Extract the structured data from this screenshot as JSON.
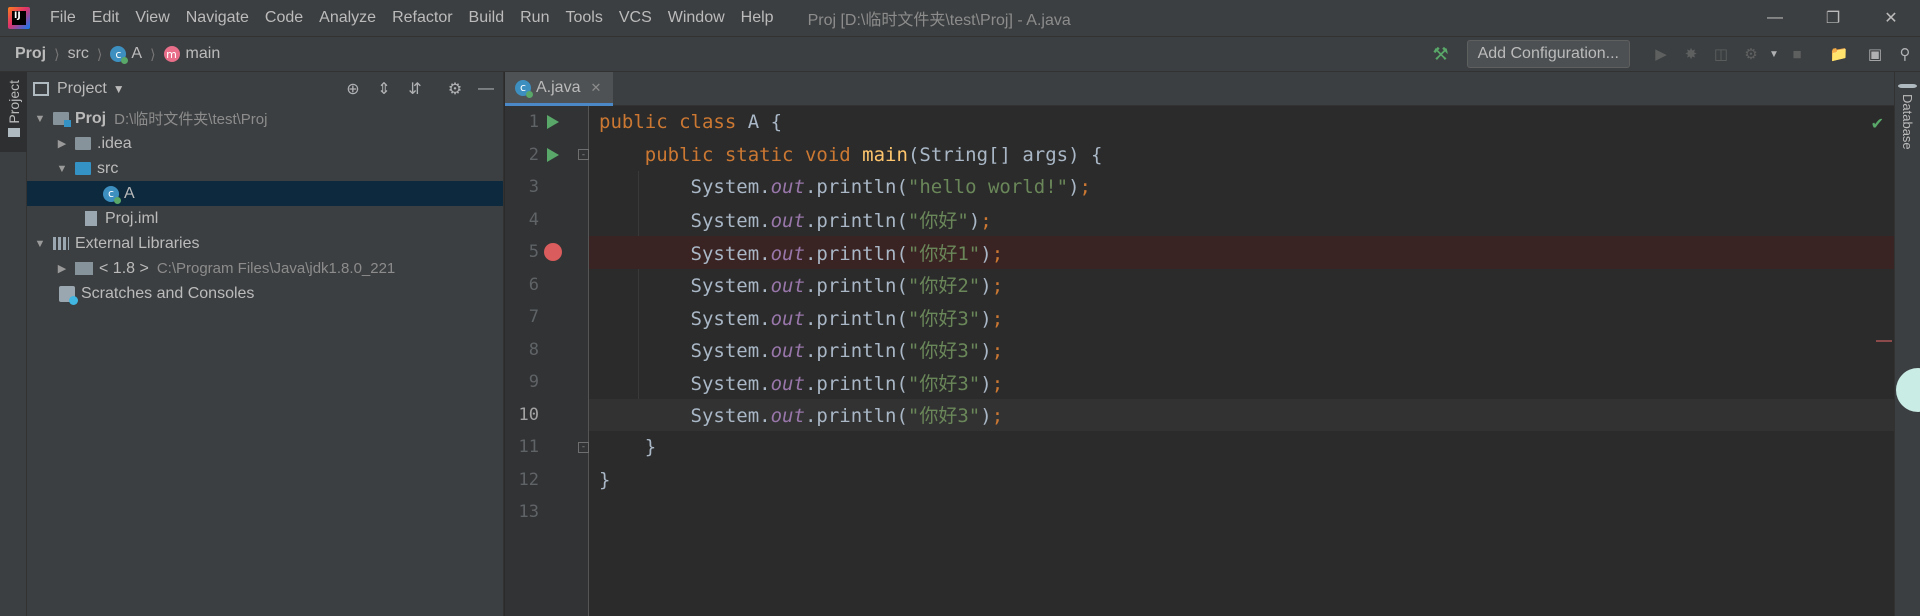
{
  "titlebar": {
    "menu": [
      "File",
      "Edit",
      "View",
      "Navigate",
      "Code",
      "Analyze",
      "Refactor",
      "Build",
      "Run",
      "Tools",
      "VCS",
      "Window",
      "Help"
    ],
    "window_title": "Proj [D:\\临时文件夹\\test\\Proj] - A.java"
  },
  "navbar": {
    "crumbs": [
      "Proj",
      "src",
      "A",
      "main"
    ],
    "add_configuration": "Add Configuration..."
  },
  "left_stripe": {
    "project_tab": "Project"
  },
  "project_panel": {
    "title": "Project",
    "tree": {
      "root_name": "Proj",
      "root_path": "D:\\临时文件夹\\test\\Proj",
      "idea": ".idea",
      "src": "src",
      "class_a": "A",
      "iml": "Proj.iml",
      "external_libraries": "External Libraries",
      "jdk_name": "< 1.8 >",
      "jdk_path": "C:\\Program Files\\Java\\jdk1.8.0_221",
      "scratches": "Scratches and Consoles"
    }
  },
  "editor": {
    "tab_label": "A.java",
    "line_numbers": [
      "1",
      "2",
      "3",
      "4",
      "5",
      "6",
      "7",
      "8",
      "9",
      "10",
      "11",
      "12",
      "13"
    ],
    "tokens": {
      "public": "public",
      "class": "class",
      "static": "static",
      "void": "void",
      "class_name": "A",
      "method_name": "main",
      "system": "System",
      "out": "out",
      "println": "println",
      "string_type": "String",
      "args": "args",
      "s1": "\"hello world!\"",
      "s2": "\"你好\"",
      "s3": "\"你好1\"",
      "s4": "\"你好2\"",
      "s5": "\"你好3\""
    },
    "breakpoint_line": 5,
    "current_line": 10
  },
  "right_stripe": {
    "database_tab": "Database"
  },
  "colors": {
    "keyword": "#cc7832",
    "function": "#ffc66d",
    "field": "#9876aa",
    "string": "#6a8759",
    "text": "#a9b7c6",
    "breakpoint": "#db5c5c",
    "run": "#59a869",
    "selection": "#0d293e"
  },
  "icons": [
    "app-logo-icon",
    "minimize-icon",
    "restore-icon",
    "close-icon",
    "hammer-icon",
    "run-icon",
    "debug-icon",
    "coverage-icon",
    "profile-icon",
    "stop-icon",
    "project-structure-icon",
    "terminal-icon",
    "search-icon",
    "target-icon",
    "expand-all-icon",
    "collapse-all-icon",
    "gear-icon",
    "hide-icon",
    "breakpoint-icon",
    "check-icon"
  ]
}
